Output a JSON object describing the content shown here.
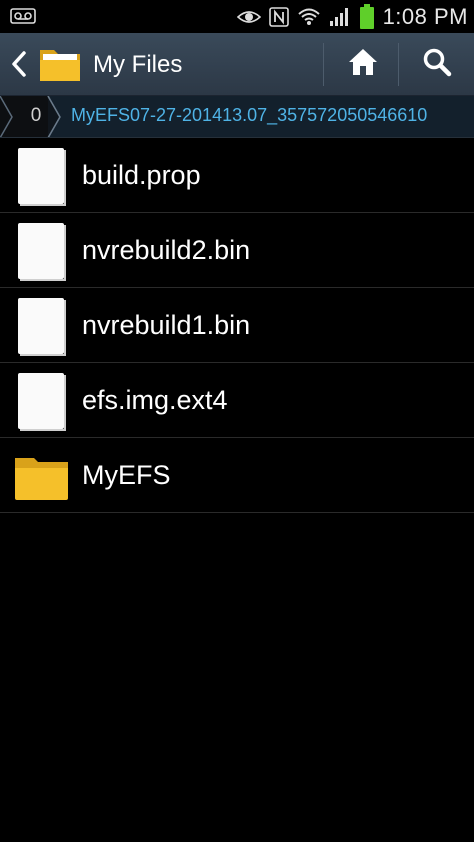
{
  "status_bar": {
    "time": "1:08 PM",
    "icons": [
      "voicemail-icon",
      "eye-icon",
      "nfc-icon",
      "wifi-icon",
      "signal-icon",
      "battery-icon"
    ],
    "battery_color": "#5fcf2a"
  },
  "action_bar": {
    "title": "My Files",
    "icons": [
      "back-arrow-icon",
      "folder-icon",
      "home-icon",
      "search-icon"
    ]
  },
  "breadcrumb": {
    "root": "0",
    "current": "MyEFS07-27-201413.07_357572050546610",
    "current_color": "#4fb3e6"
  },
  "files": [
    {
      "name": "build.prop",
      "icon": "file-icon"
    },
    {
      "name": "nvrebuild2.bin",
      "icon": "file-icon"
    },
    {
      "name": "nvrebuild1.bin",
      "icon": "file-icon"
    },
    {
      "name": "efs.img.ext4",
      "icon": "file-icon"
    },
    {
      "name": "MyEFS",
      "icon": "folder-icon"
    }
  ],
  "colors": {
    "action_bar": "#33414f",
    "folder": "#f5c02a"
  }
}
